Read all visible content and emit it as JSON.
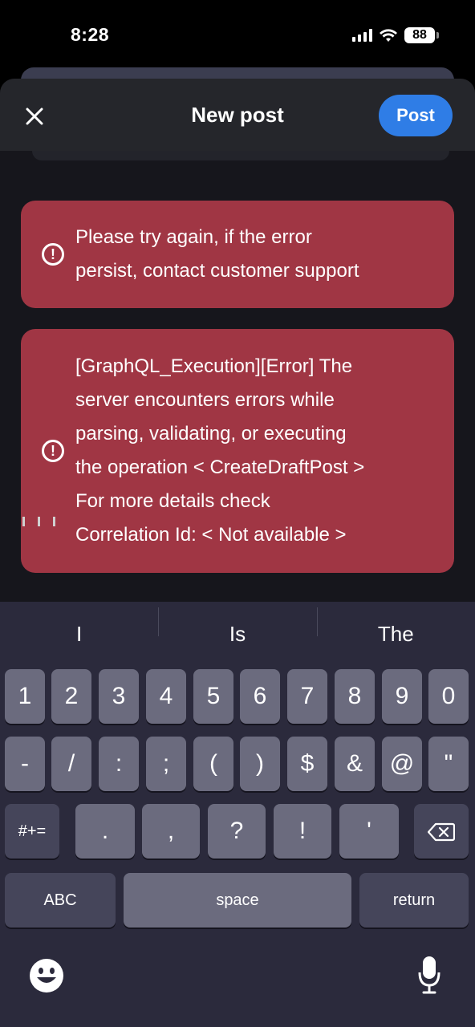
{
  "status_bar": {
    "time": "8:28",
    "battery": "88"
  },
  "header": {
    "title": "New post",
    "post_label": "Post"
  },
  "errors": [
    {
      "message": "Please try again, if the error\npersist, contact customer support"
    },
    {
      "message": "[GraphQL_Execution][Error] The\nserver encounters errors while\nparsing, validating, or executing\nthe operation < CreateDraftPost >\n For more details check\nCorrelation Id: < Not available >"
    }
  ],
  "keyboard": {
    "suggestions": [
      "I",
      "Is",
      "The"
    ],
    "row1": [
      "1",
      "2",
      "3",
      "4",
      "5",
      "6",
      "7",
      "8",
      "9",
      "0"
    ],
    "row2": [
      "-",
      "/",
      ":",
      ";",
      "(",
      ")",
      "$",
      "&",
      "@",
      "\""
    ],
    "row3": {
      "mode": "#+=",
      "keys": [
        ".",
        ",",
        "?",
        "!",
        "'"
      ]
    },
    "row4": {
      "abc": "ABC",
      "space": "space",
      "return": "return"
    }
  }
}
